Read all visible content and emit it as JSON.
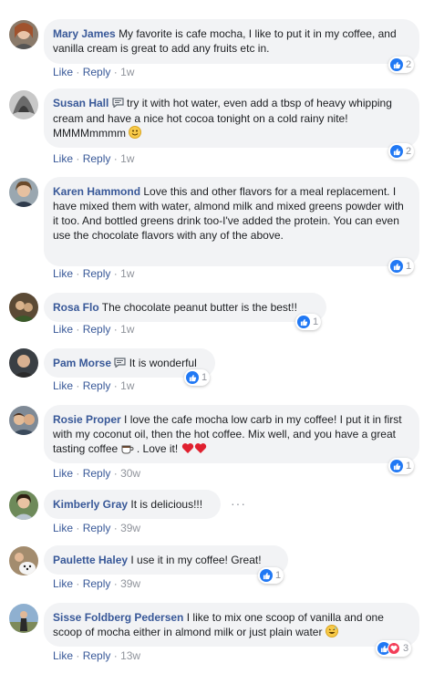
{
  "actions": {
    "like": "Like",
    "reply": "Reply",
    "sep": "·"
  },
  "comments": [
    {
      "author": "Mary James",
      "text": "My favorite is cafe mocha, I like to put it in my coffee, and vanilla cream is great to add any fruits etc in.",
      "time": "1w",
      "reactions": "2"
    },
    {
      "author": "Susan Hall",
      "text": "try it with hot water, even add a tbsp of heavy whipping cream and have a nice hot cocoa tonight on a cold rainy nite! MMMMmmmm",
      "time": "1w",
      "reactions": "2"
    },
    {
      "author": "Karen Hammond",
      "text": "Love this and other flavors for a meal replacement. I have mixed them with water, almond milk and mixed greens powder with it too. And bottled greens drink too-I've added the protein. You can even use the chocolate flavors with any of the above.",
      "time": "1w",
      "reactions": "1"
    },
    {
      "author": "Rosa Flo",
      "text": "The chocolate peanut butter is the best!!",
      "time": "1w",
      "reactions": "1"
    },
    {
      "author": "Pam Morse",
      "text": "It is wonderful",
      "time": "1w",
      "reactions": "1"
    },
    {
      "author": "Rosie Proper",
      "text": "I love the cafe mocha low carb in my coffee! I put it in first with my coconut oil, then the hot coffee. Mix well, and you have a great tasting coffee",
      "text2": ". Love it!",
      "time": "30w",
      "reactions": "1"
    },
    {
      "author": "Kimberly Gray",
      "text": "It is delicious!!!",
      "time": "39w",
      "more": "···"
    },
    {
      "author": "Paulette Haley",
      "text": "I use it in my coffee! Great!",
      "time": "39w",
      "reactions": "1"
    },
    {
      "author": "Sisse Foldberg Pedersen",
      "text": "I like to mix one scoop of vanilla and one scoop of mocha either in almond milk or just plain water",
      "time": "13w",
      "reactions": "3"
    }
  ],
  "colors": {
    "link": "#385898",
    "bubble": "#f2f3f5",
    "like": "#2078f4",
    "love": "#f33e58"
  }
}
